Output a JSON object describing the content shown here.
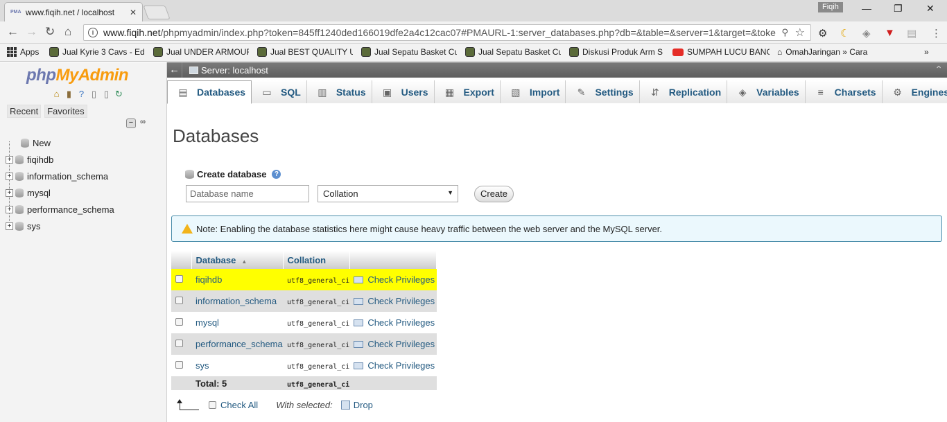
{
  "browser": {
    "tab_title": "www.fiqih.net / localhost",
    "favicon_text": "PMA",
    "profile_name": "Fiqih",
    "url_domain": "www.fiqih.net",
    "url_path": "/phpmyadmin/index.php?token=845ff1240ded166019dfe2a4c12cac07#PMAURL-1:server_databases.php?db=&table=&server=1&target=&toke",
    "bookmarks": [
      "Apps",
      "Jual Kyrie 3 Cavs - Ed:",
      "Jual UNDER ARMOUR",
      "Jual BEST QUALITY U:",
      "Jual Sepatu Basket Cu",
      "Jual Sepatu Basket Cu",
      "Diskusi Produk Arm S",
      "SUMPAH LUCU BANG",
      "OmahJaringan » Cara"
    ],
    "more_label": "»"
  },
  "nav": {
    "logo_php": "php",
    "logo_myadmin": "MyAdmin",
    "tabs": [
      "Recent",
      "Favorites"
    ],
    "tree": {
      "new_label": "New",
      "databases": [
        "fiqihdb",
        "information_schema",
        "mysql",
        "performance_schema",
        "sys"
      ]
    }
  },
  "main": {
    "server_label": "Server: localhost",
    "menu": [
      {
        "label": "Databases",
        "icon": "database-icon"
      },
      {
        "label": "SQL",
        "icon": "sql-icon"
      },
      {
        "label": "Status",
        "icon": "status-icon"
      },
      {
        "label": "Users",
        "icon": "users-icon"
      },
      {
        "label": "Export",
        "icon": "export-icon"
      },
      {
        "label": "Import",
        "icon": "import-icon"
      },
      {
        "label": "Settings",
        "icon": "wrench-icon"
      },
      {
        "label": "Replication",
        "icon": "replication-icon"
      },
      {
        "label": "Variables",
        "icon": "variables-icon"
      },
      {
        "label": "Charsets",
        "icon": "charsets-icon"
      },
      {
        "label": "Engines",
        "icon": "engines-icon"
      }
    ],
    "heading": "Databases",
    "create": {
      "label": "Create database",
      "placeholder": "Database name",
      "collation_value": "Collation",
      "button": "Create"
    },
    "notice": "Note: Enabling the database statistics here might cause heavy traffic between the web server and the MySQL server.",
    "table": {
      "headers": [
        "Database",
        "Collation"
      ],
      "rows": [
        {
          "name": "fiqihdb",
          "collation": "utf8_general_ci",
          "action": "Check Privileges"
        },
        {
          "name": "information_schema",
          "collation": "utf8_general_ci",
          "action": "Check Privileges"
        },
        {
          "name": "mysql",
          "collation": "utf8_general_ci",
          "action": "Check Privileges"
        },
        {
          "name": "performance_schema",
          "collation": "utf8_general_ci",
          "action": "Check Privileges"
        },
        {
          "name": "sys",
          "collation": "utf8_general_ci",
          "action": "Check Privileges"
        }
      ],
      "total_label": "Total: 5",
      "total_collation": "utf8_general_ci"
    },
    "footer": {
      "check_all": "Check All",
      "with_selected": "With selected:",
      "drop": "Drop"
    }
  },
  "colors": {
    "link": "#235a81",
    "highlight_row": "#ffff00",
    "logo_blue": "#6c78af",
    "logo_orange": "#f89c0e"
  }
}
